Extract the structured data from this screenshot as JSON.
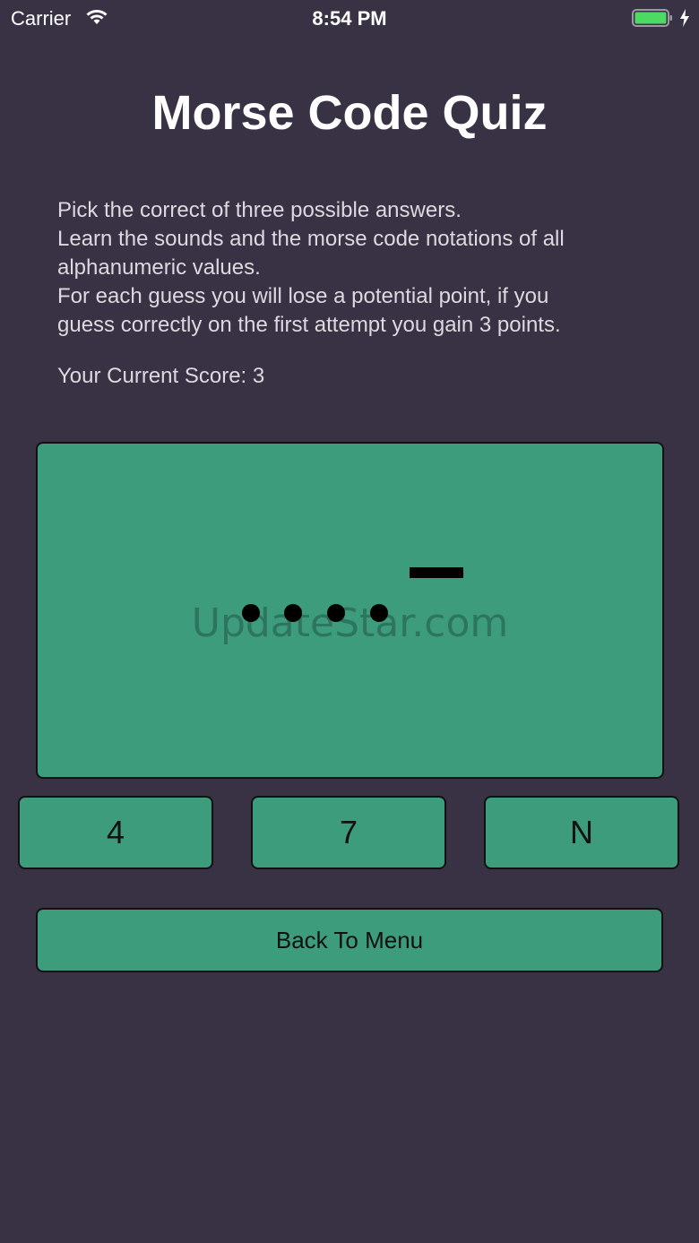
{
  "status_bar": {
    "carrier": "Carrier",
    "time": "8:54 PM",
    "wifi_icon": "wifi-icon",
    "battery_icon": "battery-icon",
    "charging_icon": "charging-bolt-icon",
    "battery_color": "#4cd964"
  },
  "title": "Morse Code Quiz",
  "instructions": {
    "line1": "Pick the correct of three possible answers.",
    "line2": "Learn the sounds and the morse code notations of all",
    "line3": "alphanumeric values.",
    "line4": "For each guess you will lose a potential point, if you",
    "line5": "guess correctly on the first attempt you gain 3 points."
  },
  "score": {
    "label": "Your Current Score: 3"
  },
  "morse_panel": {
    "symbols": [
      "dot",
      "dot",
      "dot",
      "dot",
      "dash"
    ],
    "watermark": "UpdateStar.com"
  },
  "answers": [
    {
      "label": "4"
    },
    {
      "label": "7"
    },
    {
      "label": "N"
    }
  ],
  "menu_button": {
    "label": "Back To Menu"
  },
  "colors": {
    "background": "#393244",
    "accent": "#3c9c7c",
    "border": "#111111"
  }
}
